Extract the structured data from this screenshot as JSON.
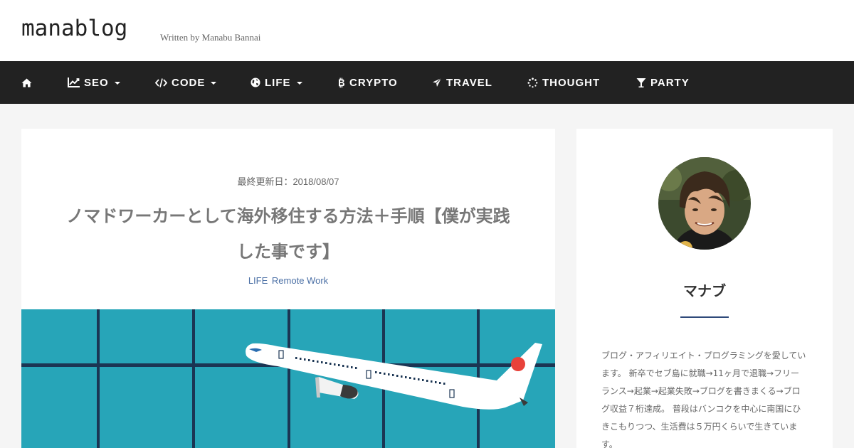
{
  "header": {
    "logo": "manablog",
    "tagline": "Written by Manabu Bannai"
  },
  "nav": {
    "home_icon": "home-icon",
    "items": [
      {
        "label": "SEO",
        "icon": "chart-line-icon",
        "dropdown": true
      },
      {
        "label": "CODE",
        "icon": "code-icon",
        "dropdown": true
      },
      {
        "label": "LIFE",
        "icon": "globe-icon",
        "dropdown": true
      },
      {
        "label": "CRYPTO",
        "icon": "bitcoin-icon",
        "dropdown": false
      },
      {
        "label": "TRAVEL",
        "icon": "plane-icon",
        "dropdown": false
      },
      {
        "label": "THOUGHT",
        "icon": "spinner-icon",
        "dropdown": false
      },
      {
        "label": "PARTY",
        "icon": "cocktail-icon",
        "dropdown": false
      }
    ]
  },
  "post": {
    "date": "最終更新日：2018/08/07",
    "title_line1": "ノマドワーカーとして海外移住する方法＋手順【僕が実践",
    "title_line2": "した事です】",
    "tags": [
      "LIFE",
      "Remote Work"
    ]
  },
  "sidebar": {
    "author_name": "マナブ",
    "bio_lines": [
      "ブログ・アフィリエイト・プログラミングを愛してい",
      "ます。 新卒でセブ島に就職→11ヶ月で退職→フリー",
      "ランス→起業→起業失敗→ブログを書きまくる→ブロ",
      "グ収益７桁達成。 普段はバンコクを中心に南国にひ",
      "きこもりつつ、生活費は５万円くらいで生きていま",
      "す。"
    ]
  },
  "colors": {
    "nav_bg": "#222222",
    "hero_bg": "#27a5b8",
    "tag_link": "#4a6fa5",
    "accent_rule": "#2f4a7a"
  }
}
